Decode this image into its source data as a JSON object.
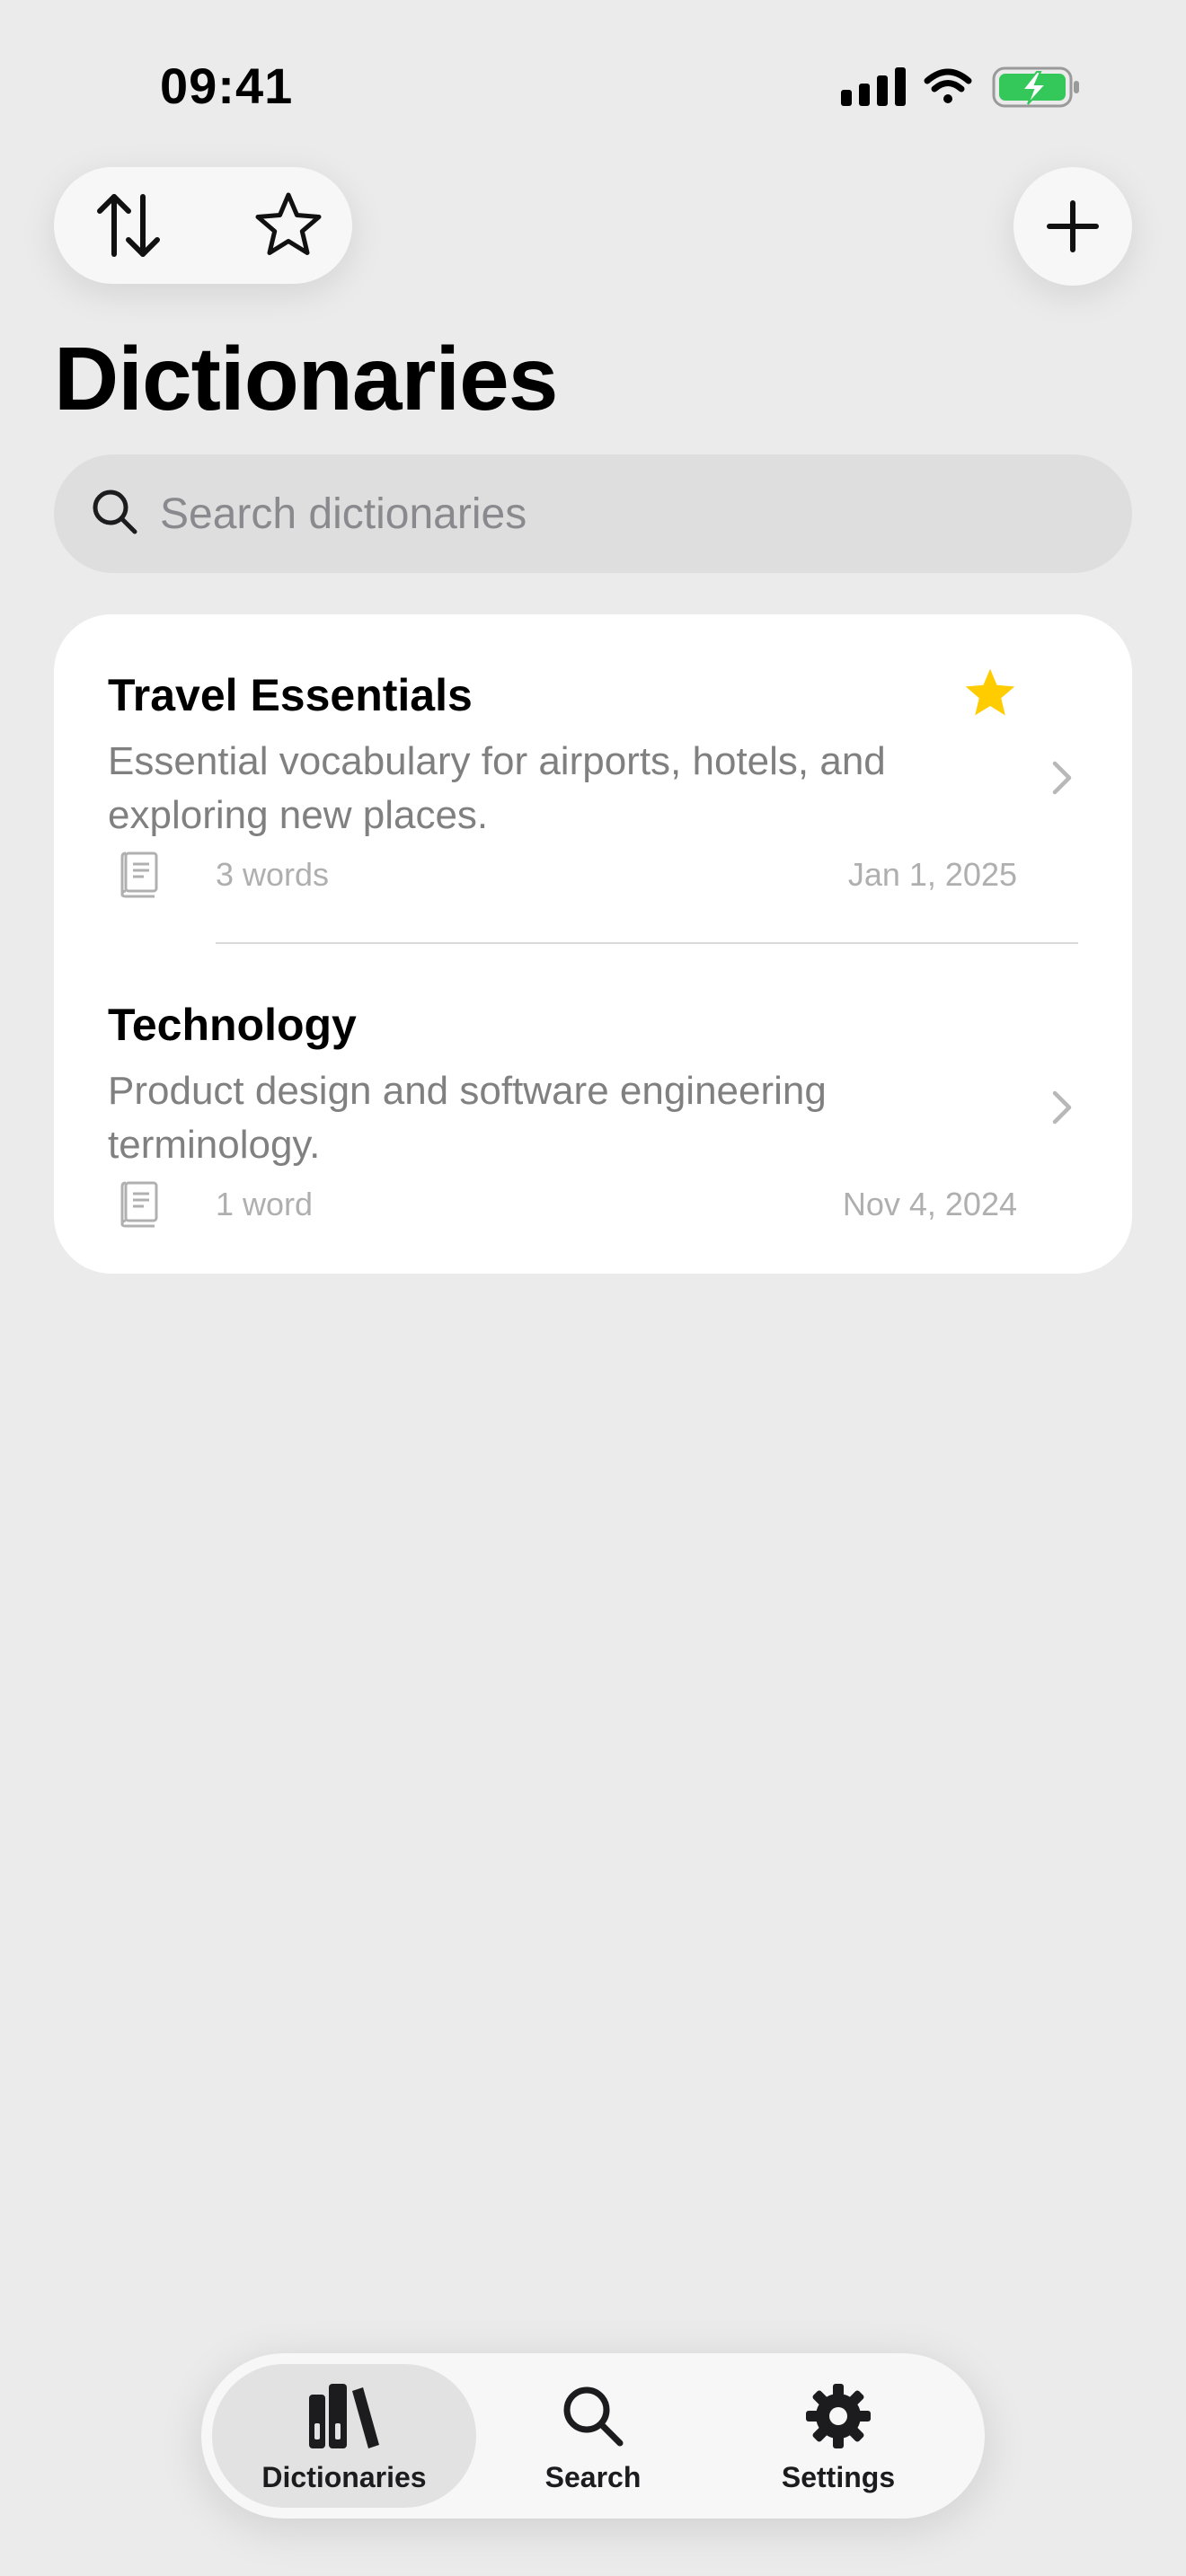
{
  "status_bar": {
    "time": "09:41",
    "icons": [
      "cellular-signal-icon",
      "wifi-icon",
      "battery-charging-icon"
    ],
    "battery_color": "#34C759"
  },
  "toolbar": {
    "left_icons": [
      "sort-icon",
      "star-outline-icon"
    ],
    "right_icon": "plus-icon"
  },
  "page": {
    "title": "Dictionaries"
  },
  "search": {
    "placeholder": "Search dictionaries",
    "value": ""
  },
  "dictionaries": [
    {
      "title": "Travel Essentials",
      "description": "Essential vocabulary for airports, hotels, and exploring new places.",
      "word_count": "3 words",
      "date": "Jan 1, 2025",
      "favorite": true
    },
    {
      "title": "Technology",
      "description": "Product design and software engineering terminology.",
      "word_count": "1 word",
      "date": "Nov 4, 2024",
      "favorite": false
    }
  ],
  "colors": {
    "background": "#EBEBEB",
    "card": "#FFFFFF",
    "favorite_star": "#FFCC00",
    "secondary_text": "#808080",
    "tertiary_text": "#AFAFAF"
  },
  "tab_bar": {
    "tabs": [
      {
        "label": "Dictionaries",
        "icon": "books-icon",
        "active": true
      },
      {
        "label": "Search",
        "icon": "search-icon",
        "active": false
      },
      {
        "label": "Settings",
        "icon": "gear-icon",
        "active": false
      }
    ]
  }
}
